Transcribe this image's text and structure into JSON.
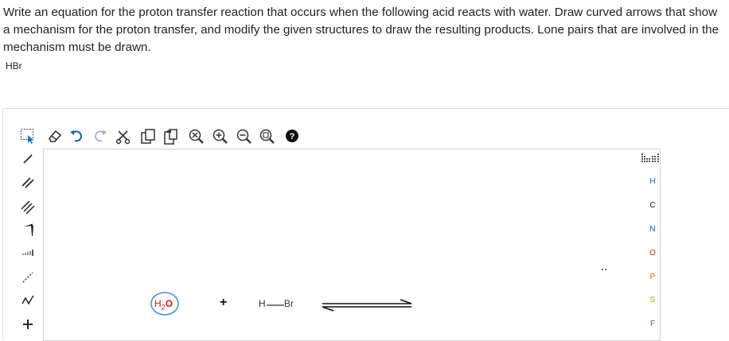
{
  "question": {
    "text": "Write an equation for the proton transfer reaction that occurs when the following acid reacts with water. Draw curved arrows that show a mechanism for the proton transfer, and modify the given structures to draw the resulting products. Lone pairs that are involved in the mechanism must be drawn.",
    "acid": "HBr"
  },
  "top_toolbar": [
    {
      "name": "select-icon"
    },
    {
      "name": "erase-icon"
    },
    {
      "name": "undo-icon"
    },
    {
      "name": "redo-icon"
    },
    {
      "name": "cut-icon"
    },
    {
      "name": "copy-icon"
    },
    {
      "name": "paste-icon"
    },
    {
      "name": "clean-icon"
    },
    {
      "name": "zoom-in-icon"
    },
    {
      "name": "zoom-out-icon"
    },
    {
      "name": "zoom-fit-icon"
    },
    {
      "name": "help-icon"
    }
  ],
  "left_toolbar": [
    {
      "name": "single-bond-icon"
    },
    {
      "name": "double-bond-icon"
    },
    {
      "name": "triple-bond-icon"
    },
    {
      "name": "wedge-bond-icon"
    },
    {
      "name": "hash-bond-icon"
    },
    {
      "name": "dashed-bond-icon"
    },
    {
      "name": "chain-icon"
    },
    {
      "name": "add-charge-icon"
    }
  ],
  "periodic_table_icon": "periodic-table-icon",
  "elements": [
    "H",
    "C",
    "N",
    "O",
    "P",
    "S",
    "F"
  ],
  "colors": {
    "h": "#1f4fd0",
    "n": "#1f4fd0",
    "o": "#e01414",
    "p": "#d07000",
    "s": "#b8a200",
    "f": "#2d8f2d",
    "c": "#222222",
    "water_ring": "#4a8fd6"
  },
  "reaction": {
    "water_h": "H",
    "water_sub": "2",
    "water_o": "O",
    "plus": "+",
    "hbr_h": "H",
    "hbr_br": "Br",
    "arrow": "equilibrium-arrow",
    "lone_pair": ":"
  }
}
